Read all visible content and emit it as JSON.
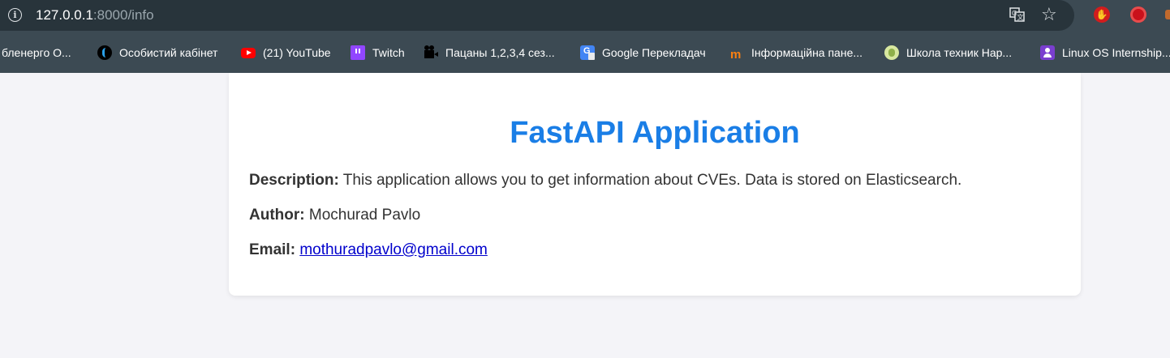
{
  "browser": {
    "url_host": "127.0.0.1",
    "url_rest": ":8000/info",
    "bookmarks": [
      {
        "label": "бленерго О...",
        "icon": "none"
      },
      {
        "label": "Особистий кабінет",
        "icon": "swirl-icon"
      },
      {
        "label": "(21) YouTube",
        "icon": "youtube-icon"
      },
      {
        "label": "Twitch",
        "icon": "twitch-icon"
      },
      {
        "label": "Пацаны 1,2,3,4 сез...",
        "icon": "camera-icon"
      },
      {
        "label": "Google Перекладач",
        "icon": "google-translate-icon"
      },
      {
        "label": "Інформаційна пане...",
        "icon": "moodle-icon"
      },
      {
        "label": "Школа техник Нар...",
        "icon": "school-icon"
      },
      {
        "label": "Linux OS Internship...",
        "icon": "classroom-icon"
      }
    ]
  },
  "page": {
    "title": "FastAPI Application",
    "description_label": "Description:",
    "description_text": "This application allows you to get information about CVEs. Data is stored on Elasticsearch.",
    "author_label": "Author:",
    "author_text": "Mochurad Pavlo",
    "email_label": "Email:",
    "email_link": "mothuradpavlo@gmail.com"
  },
  "colors": {
    "title": "#1a7ee6",
    "link": "#0000cc",
    "page_bg": "#f4f4f8",
    "chrome_bg": "#3c4a53"
  }
}
